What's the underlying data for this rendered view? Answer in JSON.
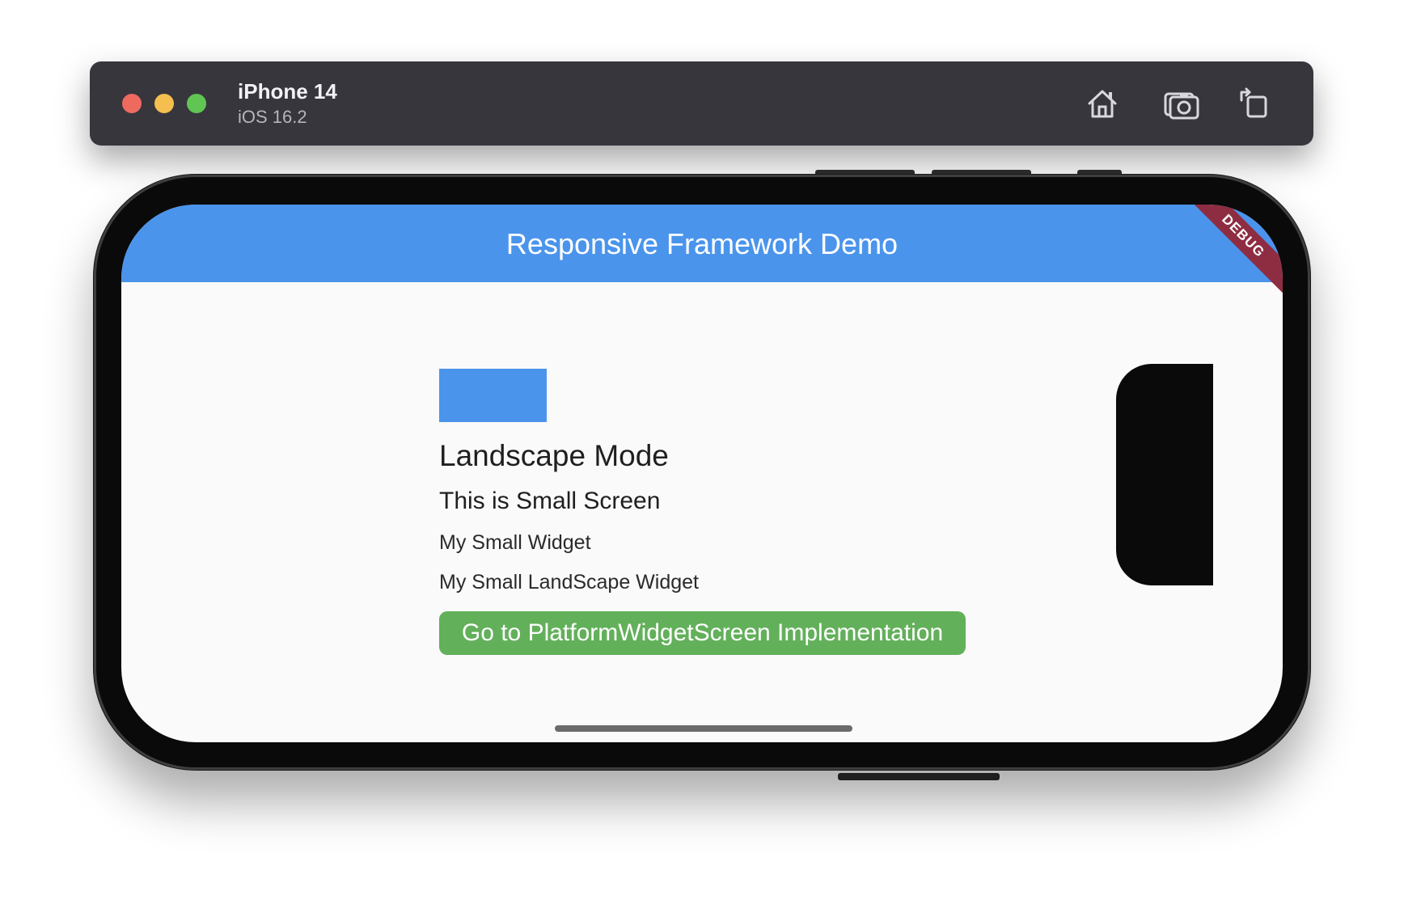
{
  "simulator": {
    "device_name": "iPhone 14",
    "os_version": "iOS 16.2",
    "toolbar_icons": [
      "home-icon",
      "screenshot-icon",
      "rotate-icon"
    ],
    "traffic_lights": {
      "close": "#ee6a5f",
      "minimize": "#f5bf4f",
      "zoom": "#61c554"
    }
  },
  "app": {
    "title": "Responsive Framework Demo",
    "debug_banner": "DEBUG",
    "accent_color": "#4a94ec",
    "orientation_label": "Landscape Mode",
    "screen_label": "This is Small Screen",
    "widget_label": "My Small Widget",
    "landscape_widget_label": "My Small LandScape Widget",
    "action_button": "Go to PlatformWidgetScreen Implementation",
    "action_button_color": "#63b05b"
  }
}
